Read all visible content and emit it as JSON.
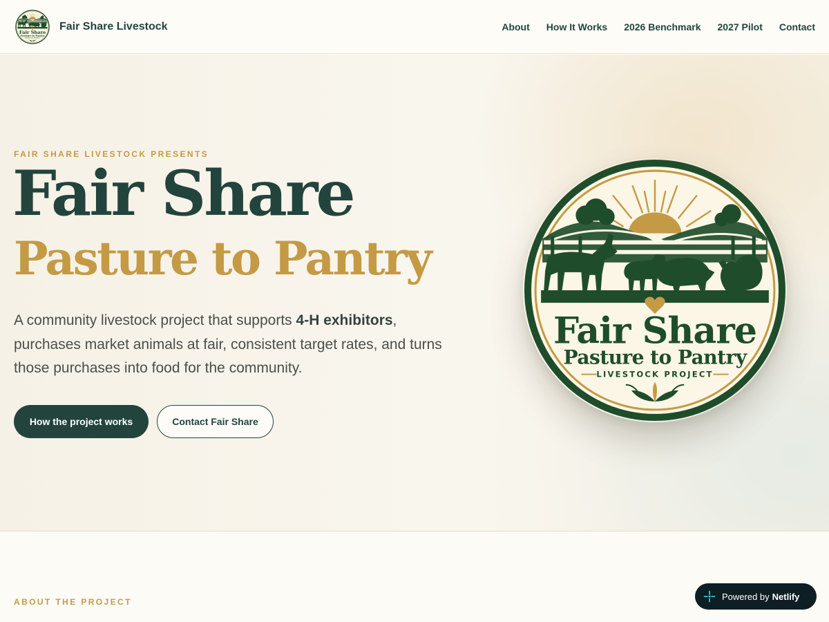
{
  "header": {
    "brand_name": "Fair Share Livestock",
    "nav": [
      "About",
      "How It Works",
      "2026 Benchmark",
      "2027 Pilot",
      "Contact"
    ]
  },
  "hero": {
    "eyebrow": "FAIR SHARE LIVESTOCK PRESENTS",
    "title": "Fair Share",
    "subtitle": "Pasture to Pantry",
    "body_before": "A community livestock project that supports ",
    "body_bold": "4-H exhibitors",
    "body_after": ", purchases market animals at fair, consistent target rates, and turns those purchases into food for the community.",
    "primary_button": "How the project works",
    "secondary_button": "Contact Fair Share"
  },
  "badge": {
    "line1": "Fair Share",
    "line2": "Pasture to Pantry",
    "line3": "LIVESTOCK PROJECT"
  },
  "about": {
    "eyebrow": "ABOUT THE PROJECT"
  },
  "netlify": {
    "prefix": "Powered by",
    "brand": "Netlify"
  },
  "colors": {
    "primary": "#22443d",
    "accent_gold": "#c49a45",
    "badge_green": "#1f4d2b",
    "badge_cream": "#fbf6e6",
    "netlify_bg": "#0e1e25"
  },
  "icons": [
    "logo-badge-icon",
    "netlify-icon"
  ]
}
